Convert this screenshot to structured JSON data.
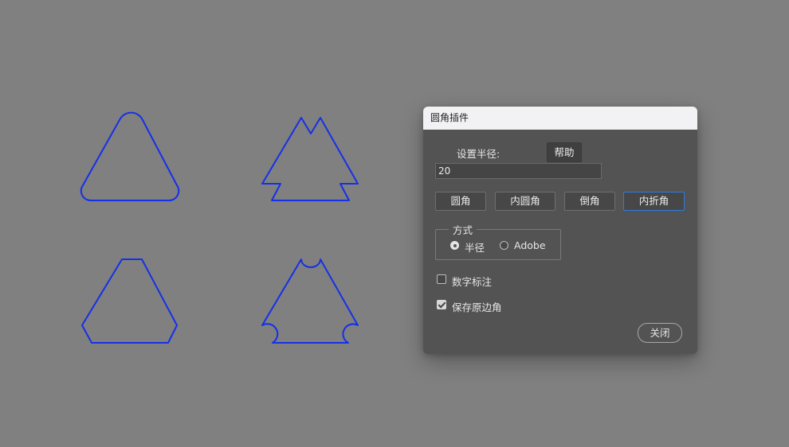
{
  "canvas": {
    "stroke_color": "#1530e8",
    "background": "#808080",
    "shapes": [
      "rounded-triangle",
      "inner-fold-triangle",
      "chamfered-triangle",
      "inner-rounded-triangle"
    ]
  },
  "dialog": {
    "title": "圆角插件",
    "radius_label": "设置半径:",
    "help_label": "帮助",
    "radius_value": "20",
    "buttons": {
      "round": "圆角",
      "inner_round": "内圆角",
      "chamfer": "倒角",
      "inner_fold": "内折角"
    },
    "active_button": "inner_fold",
    "mode_group": {
      "legend": "方式",
      "options": [
        "半径",
        "Adobe"
      ],
      "selected": "半径"
    },
    "checkboxes": {
      "number_label": {
        "label": "数字标注",
        "checked": false
      },
      "keep_original": {
        "label": "保存原边角",
        "checked": true
      }
    },
    "close_label": "关闭",
    "accent_color": "#2f7ae5"
  }
}
